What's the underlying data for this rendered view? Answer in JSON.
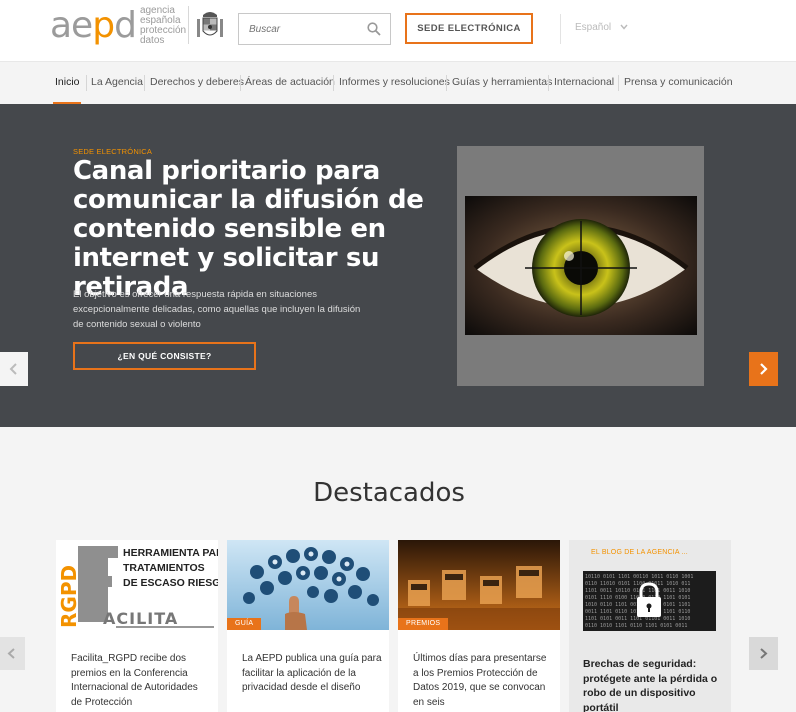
{
  "header": {
    "logo_word_a": "ae",
    "logo_word_p": "p",
    "logo_word_d": "d",
    "logo_lines": [
      "agencia",
      "española",
      "protección",
      "datos"
    ],
    "search_placeholder": "Buscar",
    "sede_button": "SEDE ELECTRÓNICA",
    "language": "Español"
  },
  "nav": {
    "items": [
      {
        "label": "Inicio"
      },
      {
        "label": "La Agencia"
      },
      {
        "label": "Derechos y deberes"
      },
      {
        "label": "Áreas de actuación"
      },
      {
        "label": "Informes y resoluciones"
      },
      {
        "label": "Guías y herramientas"
      },
      {
        "label": "Internacional"
      },
      {
        "label": "Prensa y comunicación"
      }
    ]
  },
  "hero": {
    "kicker": "SEDE ELECTRÓNICA",
    "title": "Canal prioritario para comunicar la difusión de contenido sensible en internet y solicitar su retirada",
    "description": "El objetivo es ofrecer una respuesta rápida en situaciones excepcionalmente delicadas, como aquellas que incluyen la difusión de contenido sexual o violento",
    "button": "¿EN QUÉ CONSISTE?"
  },
  "destacados": {
    "title": "Destacados",
    "cards": [
      {
        "img_lines": [
          "HERRAMIENTA PARA",
          "TRATAMIENTOS",
          "DE ESCASO RIESGO"
        ],
        "img_brand": "RGPD",
        "img_word": "ACILITA",
        "text": "Facilita_RGPD recibe dos premios en la Conferencia Internacional de Autoridades de Protección"
      },
      {
        "tag": "GUÍA",
        "text": "La AEPD publica una guía para facilitar la aplicación de la privacidad desde el diseño"
      },
      {
        "tag": "PREMIOS",
        "text": "Últimos días para presentarse a los Premios Protección de Datos 2019, que se convocan en seis"
      },
      {
        "kicker": "EL BLOG DE LA AGENCIA ...",
        "text": "Brechas de seguridad: protégete ante la pérdida o robo de un dispositivo portátil"
      }
    ]
  },
  "colors": {
    "accent": "#e8731a",
    "hero_bg": "#45484c",
    "page_bg": "#f4f4f4"
  }
}
